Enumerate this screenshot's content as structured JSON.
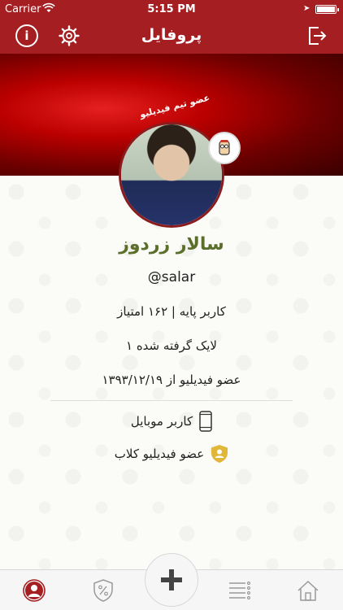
{
  "status": {
    "carrier": "Carrier",
    "time": "5:15 PM"
  },
  "nav": {
    "title": "پروفایل"
  },
  "profile": {
    "team_badge": "عضو تیم فیدیلیو",
    "name": "سالار زردوز",
    "username": "@salar",
    "level_points": "کاربر پایه | ۱۶۲ امتیاز",
    "likes": "۱ لایک گرفته شده",
    "member_since": "عضو فیدیلیو از ۱۳۹۳/۱۲/۱۹"
  },
  "features": [
    {
      "label": "کاربر موبایل",
      "icon": "mobile-phone-icon"
    },
    {
      "label": "عضو فیدیلیو کلاب",
      "icon": "club-shield-icon"
    }
  ],
  "tabs": [
    {
      "name": "profile",
      "icon": "user-icon",
      "active": true
    },
    {
      "name": "offers",
      "icon": "discount-shield-icon"
    },
    {
      "name": "add",
      "icon": "plus-icon"
    },
    {
      "name": "list",
      "icon": "list-icon"
    },
    {
      "name": "home",
      "icon": "home-icon"
    }
  ],
  "colors": {
    "brand": "#a51e22",
    "name": "#5b6f2a",
    "badge": "#e1b73a"
  }
}
